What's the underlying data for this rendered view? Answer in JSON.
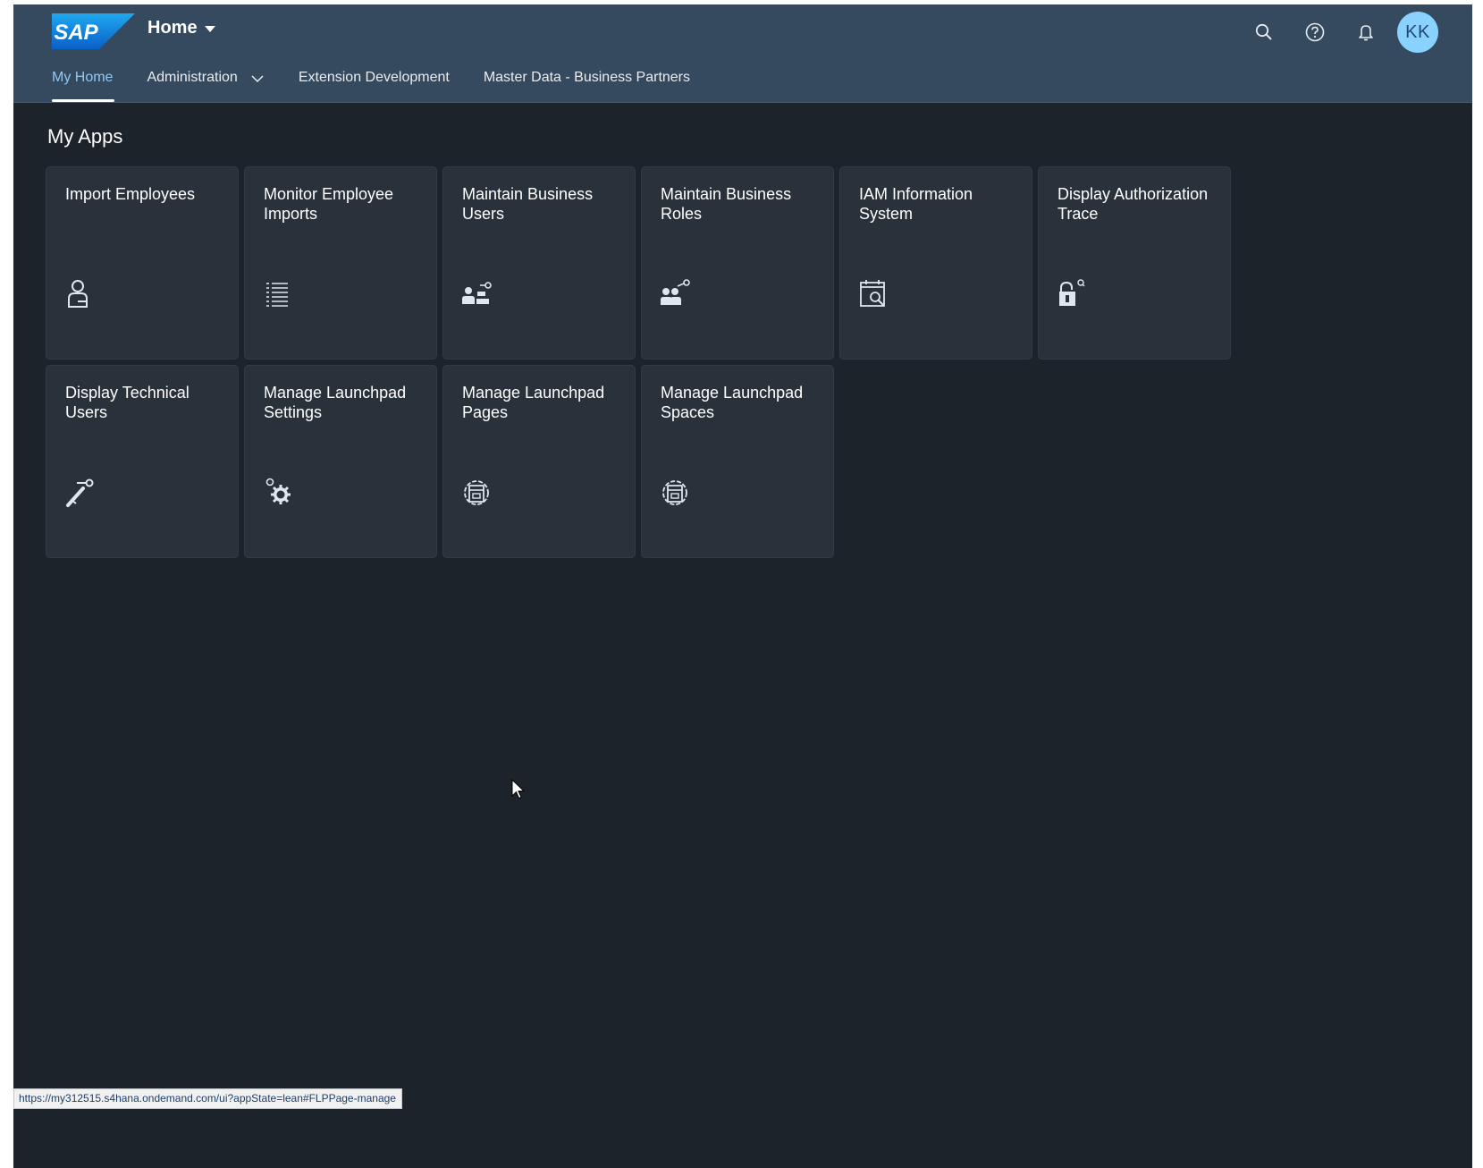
{
  "shell": {
    "logo_text": "SAP",
    "app_title": "Home",
    "user_initials": "KK",
    "icons": [
      "search-icon",
      "help-icon",
      "bell-icon"
    ],
    "colors": {
      "header": "#354a5f",
      "background": "#1d232a",
      "tile": "#29313a",
      "active_tab": "#91c8f6",
      "avatar": "#89d1ff"
    }
  },
  "nav": {
    "tabs": [
      {
        "label": "My Home",
        "active": true
      },
      {
        "label": "Administration",
        "has_dropdown": true
      },
      {
        "label": "Extension Development"
      },
      {
        "label": "Master Data - Business Partners"
      }
    ]
  },
  "section": {
    "title": "My Apps"
  },
  "tiles": [
    {
      "title": "Import Employees",
      "icon": "employee-icon"
    },
    {
      "title": "Monitor Employee Imports",
      "icon": "list-icon"
    },
    {
      "title": "Maintain Business Users",
      "icon": "business-users-icon"
    },
    {
      "title": "Maintain Business Roles",
      "icon": "business-roles-icon"
    },
    {
      "title": "IAM Information System",
      "icon": "calendar-search-icon"
    },
    {
      "title": "Display Authorization Trace",
      "icon": "lock-search-icon"
    },
    {
      "title": "Display Technical Users",
      "icon": "technical-user-icon"
    },
    {
      "title": "Manage Launchpad Settings",
      "icon": "settings-gears-icon"
    },
    {
      "title": "Manage Launchpad Pages",
      "icon": "launchpad-pages-icon"
    },
    {
      "title": "Manage Launchpad Spaces",
      "icon": "launchpad-spaces-icon"
    }
  ],
  "status_bar": {
    "url": "https://my312515.s4hana.ondemand.com/ui?appState=lean#FLPPage-manage"
  }
}
